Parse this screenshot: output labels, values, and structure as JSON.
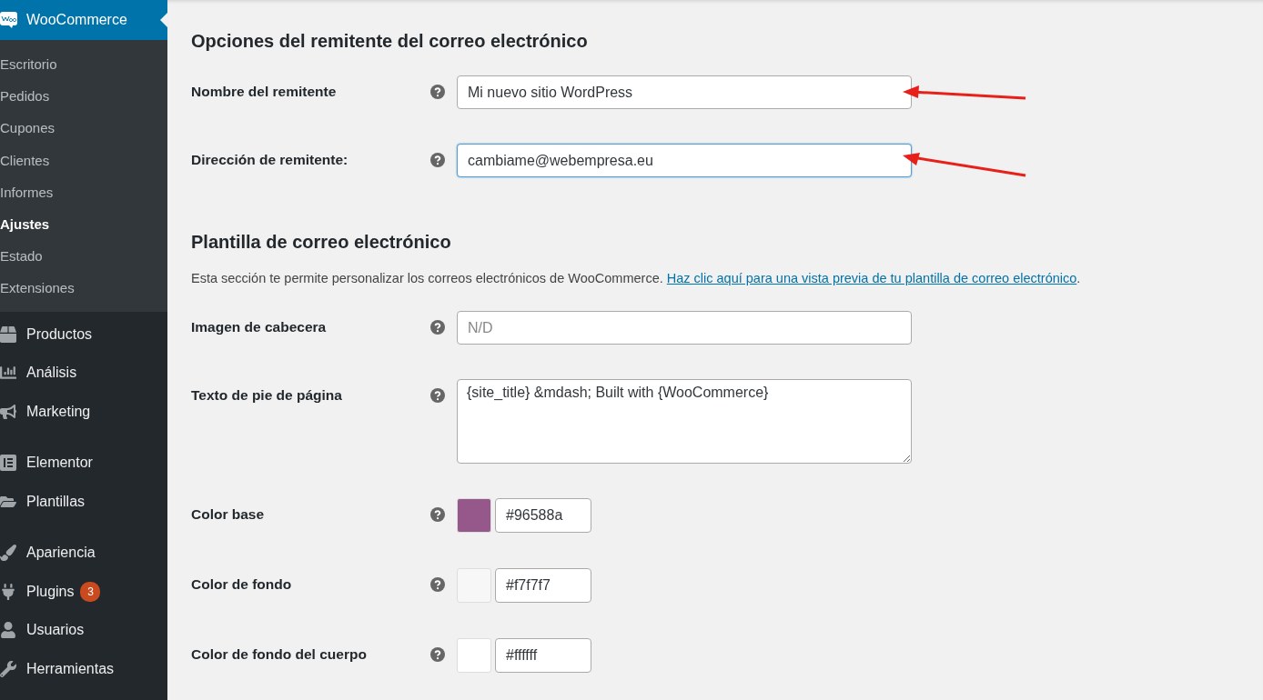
{
  "sidebar": {
    "header": {
      "label": "WooCommerce"
    },
    "submenu": [
      {
        "label": "Escritorio",
        "selected": false
      },
      {
        "label": "Pedidos",
        "selected": false
      },
      {
        "label": "Cupones",
        "selected": false
      },
      {
        "label": "Clientes",
        "selected": false
      },
      {
        "label": "Informes",
        "selected": false
      },
      {
        "label": "Ajustes",
        "selected": true
      },
      {
        "label": "Estado",
        "selected": false
      },
      {
        "label": "Extensiones",
        "selected": false
      }
    ],
    "menu": [
      {
        "label": "Productos"
      },
      {
        "label": "Análisis"
      },
      {
        "label": "Marketing"
      },
      {
        "label": "Elementor"
      },
      {
        "label": "Plantillas"
      },
      {
        "label": "Apariencia"
      },
      {
        "label": "Plugins",
        "badge": "3"
      },
      {
        "label": "Usuarios"
      },
      {
        "label": "Herramientas"
      }
    ]
  },
  "sections": [
    {
      "title": "Opciones del remitente del correo electrónico",
      "fields": [
        {
          "kind": "text",
          "label": "Nombre del remitente",
          "value": "Mi nuevo sitio WordPress",
          "focused": false,
          "arrow": true
        },
        {
          "kind": "text",
          "label": "Dirección de remitente:",
          "value": "cambiame@webempresa.eu",
          "focused": true,
          "arrow": true
        }
      ]
    },
    {
      "title": "Plantilla de correo electrónico",
      "description": "Esta sección te permite personalizar los correos electrónicos de WooCommerce.",
      "link": "Haz clic aquí para una vista previa de tu plantilla de correo electrónico",
      "after_link": ".",
      "fields": [
        {
          "kind": "text",
          "label": "Imagen de cabecera",
          "placeholder": "N/D",
          "focused": false,
          "arrow": false
        },
        {
          "kind": "textarea",
          "label": "Texto de pie de página",
          "value": "{site_title} &mdash; Built with {WooCommerce}",
          "focused": false,
          "arrow": false
        },
        {
          "kind": "color",
          "label": "Color base",
          "value": "#96588a",
          "color": "#96588a"
        },
        {
          "kind": "color",
          "label": "Color de fondo",
          "value": "#f7f7f7",
          "color": "#f7f7f7"
        },
        {
          "kind": "color",
          "label": "Color de fondo del cuerpo",
          "value": "#ffffff",
          "color": "#ffffff"
        }
      ]
    }
  ]
}
